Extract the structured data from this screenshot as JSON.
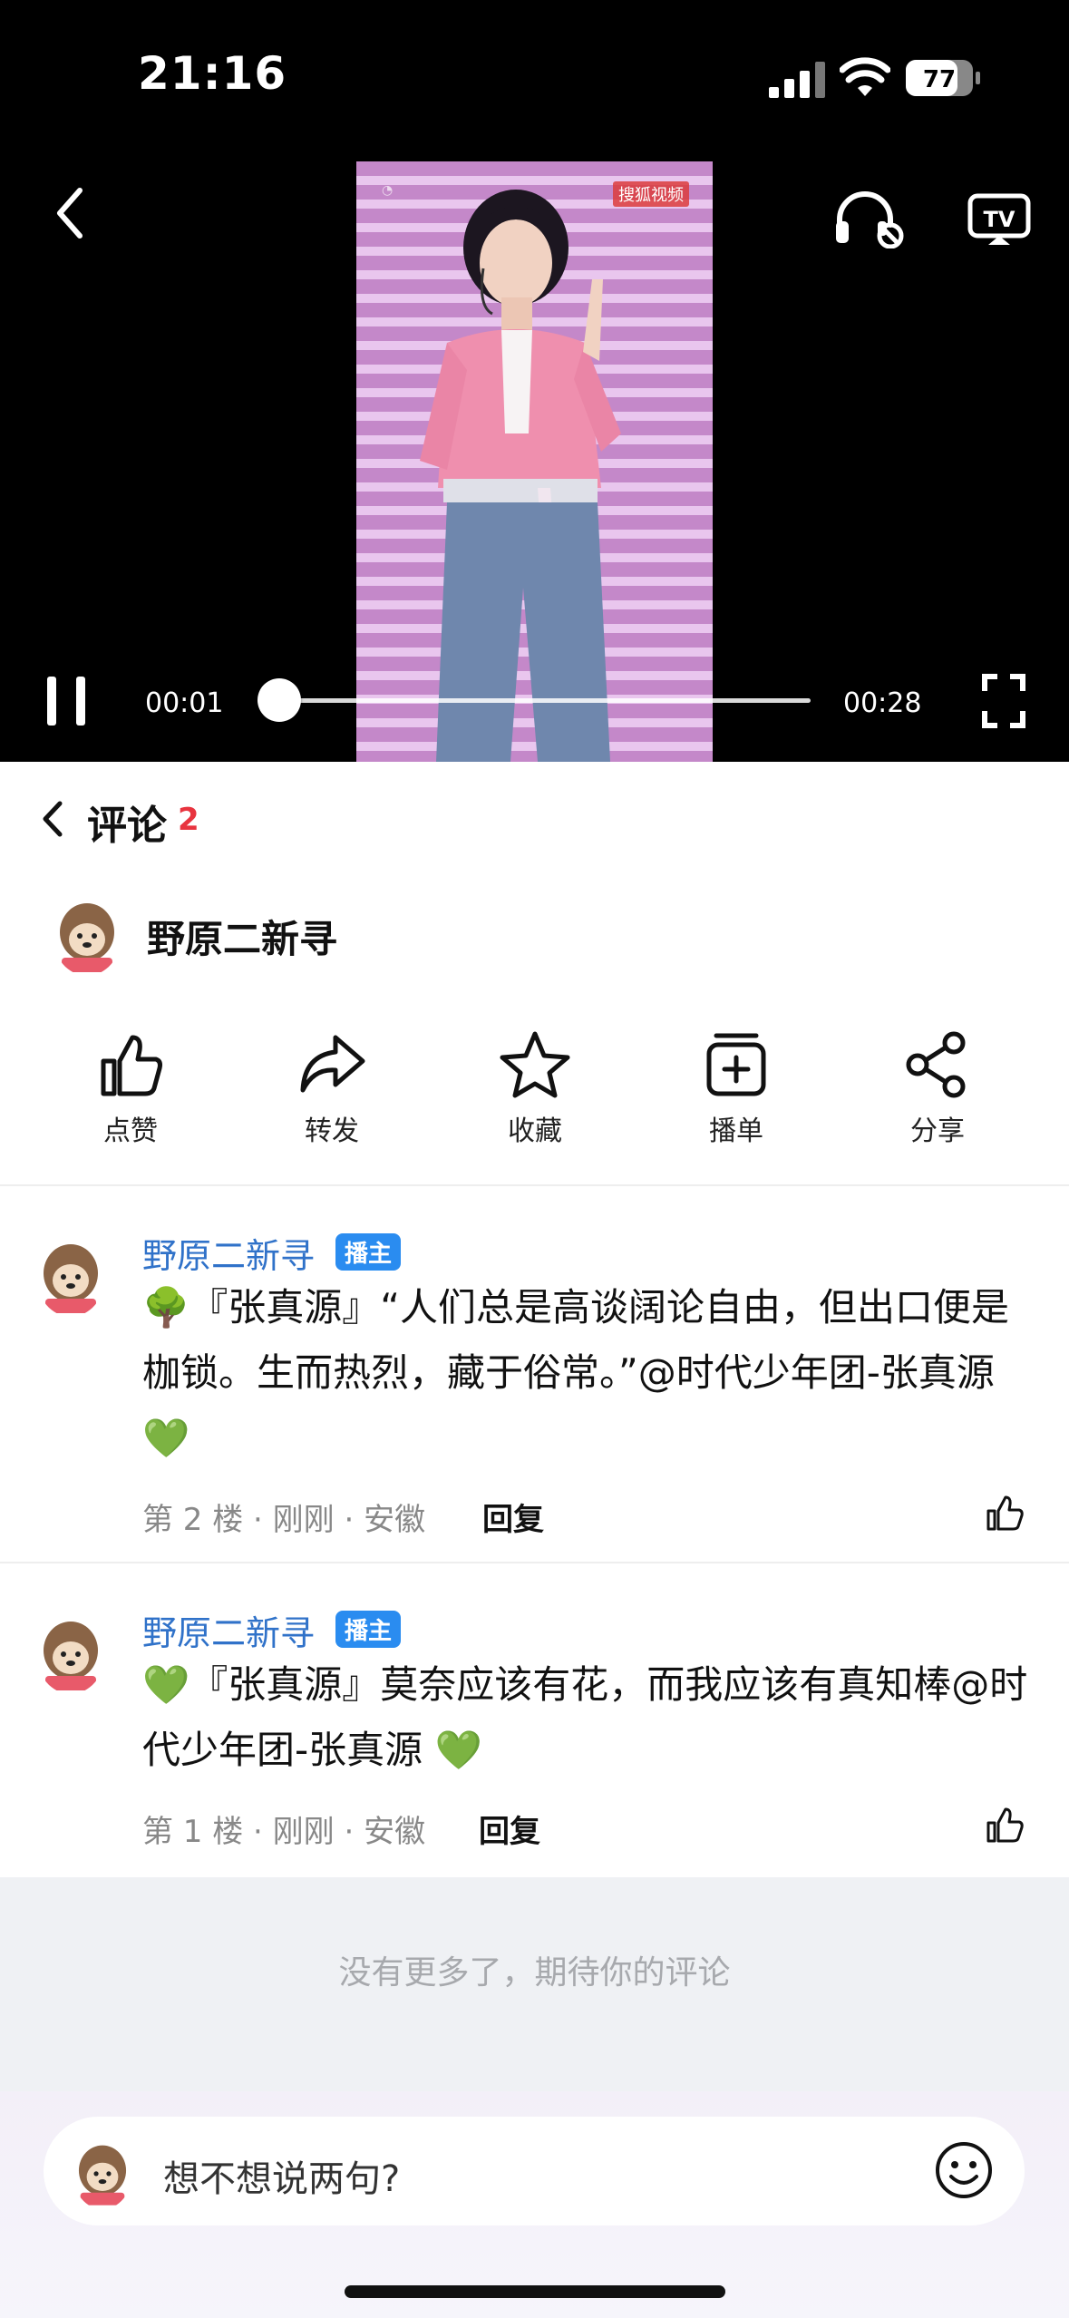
{
  "status_bar": {
    "time": "21:16",
    "battery": "77",
    "battery_level_percent": 77
  },
  "player": {
    "current_time": "00:01",
    "total_time": "00:28",
    "progress_fraction": 0.04,
    "overlay_badge": "搜狐视频",
    "icons": [
      "back-icon",
      "headphone-icon",
      "tv-cast-icon",
      "pause-icon",
      "fullscreen-icon"
    ]
  },
  "comments_header": {
    "title": "评论",
    "count": "2"
  },
  "author": {
    "name": "野原二新寻"
  },
  "actions": [
    {
      "label": "点赞",
      "icon": "like-icon"
    },
    {
      "label": "转发",
      "icon": "forward-icon"
    },
    {
      "label": "收藏",
      "icon": "star-icon"
    },
    {
      "label": "播单",
      "icon": "playlist-add-icon"
    },
    {
      "label": "分享",
      "icon": "share-icon"
    }
  ],
  "comments": [
    {
      "author": "野原二新寻",
      "badge": "播主",
      "text": "🌳『张真源』“人们总是高谈阔论自由，但出口便是枷锁。生而热烈，藏于俗常。”@时代少年团-张真源 💚",
      "meta": "第 2 楼 · 刚刚 · 安徽",
      "reply": "回复"
    },
    {
      "author": "野原二新寻",
      "badge": "播主",
      "text": "💚『张真源』莫奈应该有花，而我应该有真知棒@时代少年团-张真源 💚",
      "meta": "第 1 楼 · 刚刚 · 安徽",
      "reply": "回复"
    }
  ],
  "footer": {
    "no_more": "没有更多了，期待你的评论"
  },
  "input": {
    "placeholder": "想不想说两句?"
  },
  "colors": {
    "accent_red": "#e8343f",
    "link_blue": "#3072c9",
    "badge_blue": "#2a8cf0"
  }
}
